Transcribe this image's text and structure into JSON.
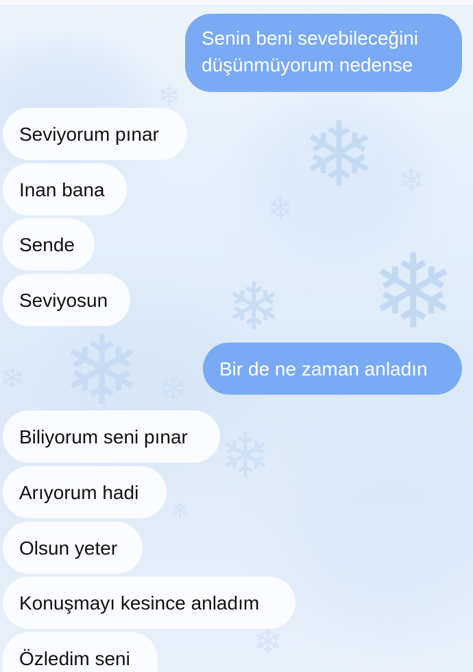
{
  "messages": [
    {
      "text": "Senin beni sevebileceğini düşünmüyorum nedense",
      "direction": "outgoing"
    },
    {
      "text": "Seviyorum pınar",
      "direction": "incoming"
    },
    {
      "text": "Inan bana",
      "direction": "incoming"
    },
    {
      "text": "Sende",
      "direction": "incoming"
    },
    {
      "text": "Seviyosun",
      "direction": "incoming"
    },
    {
      "text": "Bir de ne zaman anladın",
      "direction": "outgoing"
    },
    {
      "text": "Biliyorum seni pınar",
      "direction": "incoming"
    },
    {
      "text": "Arıyorum hadi",
      "direction": "incoming"
    },
    {
      "text": "Olsun yeter",
      "direction": "incoming"
    },
    {
      "text": "Konuşmayı kesince anladım",
      "direction": "incoming"
    },
    {
      "text": "Özledim seni",
      "direction": "incoming"
    }
  ],
  "colors": {
    "outgoing_bubble": "#7aaaf4",
    "incoming_bubble": "#fafcff",
    "background": "#e3eefa"
  },
  "background_icons": [
    "snowflake-icon"
  ]
}
